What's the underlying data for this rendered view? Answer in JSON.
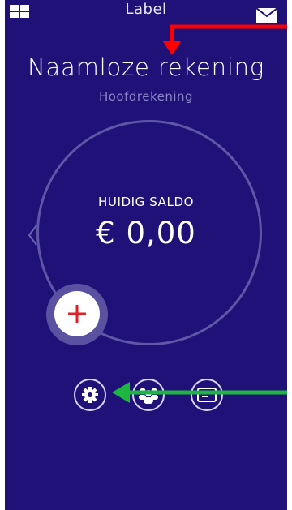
{
  "header": {
    "title": "Label"
  },
  "account": {
    "name": "Naamloze rekening",
    "type": "Hoofdrekening"
  },
  "balance": {
    "label": "HUIDIG SALDO",
    "amount": "€ 0,00"
  },
  "icons": {
    "menu": "grid-icon",
    "mail": "mail-icon",
    "add": "plus-icon",
    "settings": "gear-icon",
    "people": "people-icon",
    "card": "card-icon",
    "prev": "chevron-left-icon"
  },
  "colors": {
    "background": "#1f1178",
    "ring": "#5f56a7",
    "accent_red": "#e11f26",
    "annotation_red": "#ff0000",
    "annotation_green": "#1db640"
  }
}
